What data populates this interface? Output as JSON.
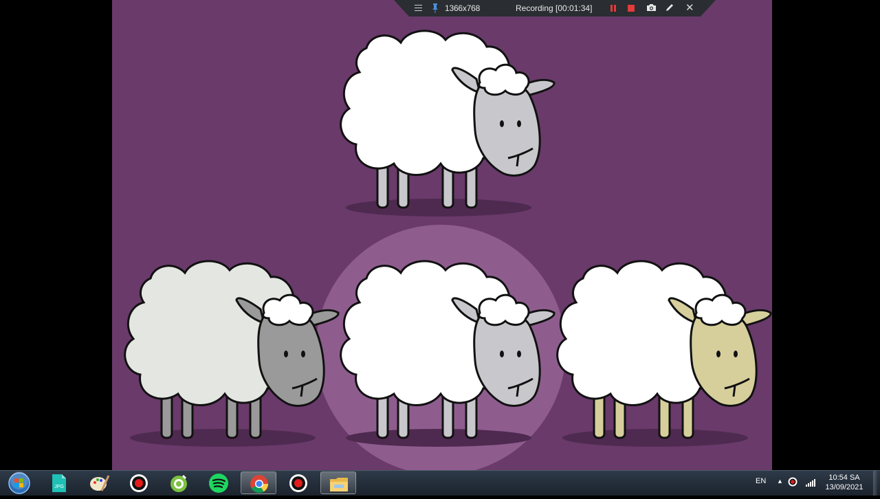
{
  "recorder": {
    "resolution": "1366x768",
    "status": "Recording [00:01:34]",
    "icons": [
      "menu-icon",
      "pin-icon",
      "pause-icon",
      "stop-icon",
      "camera-icon",
      "pen-icon",
      "close-icon"
    ]
  },
  "scene": {
    "background": "#693a6a",
    "highlight": "#9b6a9b",
    "sheep": [
      {
        "name": "top-sheep",
        "wool": "#ffffff",
        "face": "#c8c8cc",
        "legs": "#c8c8cc"
      },
      {
        "name": "grey-sheep",
        "wool": "#e4e6e2",
        "face": "#9a9a9a",
        "legs": "#9a9a9a"
      },
      {
        "name": "center-sheep",
        "wool": "#ffffff",
        "face": "#c8c8cc",
        "legs": "#c8c8cc"
      },
      {
        "name": "tan-sheep",
        "wool": "#ffffff",
        "face": "#d6cf9c",
        "legs": "#d6cf9c"
      }
    ]
  },
  "taskbar": {
    "apps": [
      "start-orb-icon",
      "jpg-converter-icon",
      "paint-icon",
      "recorder-icon",
      "greenshot-icon",
      "spotify-icon",
      "chrome-icon",
      "recorder-icon",
      "file-explorer-icon"
    ],
    "language": "EN",
    "time": "10:54 SA",
    "date": "13/09/2021"
  }
}
